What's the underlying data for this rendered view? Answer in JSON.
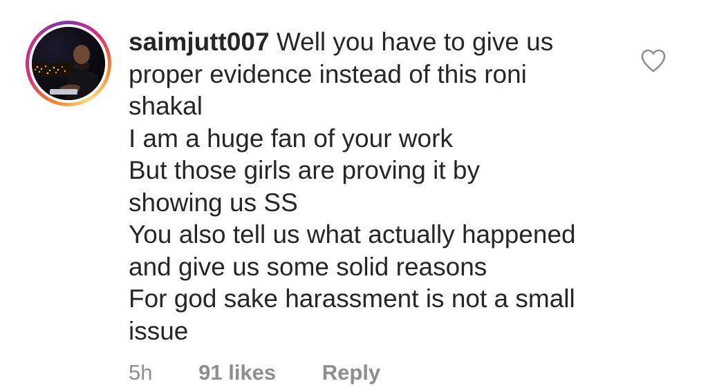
{
  "comment": {
    "username": "saimjutt007",
    "lines": [
      "Well you have to give us",
      "proper evidence instead of this roni",
      "shakal",
      "I am a huge fan of your work",
      "But those girls are proving it by",
      "showing us SS",
      "You also tell us what actually happened",
      "and give us some solid reasons",
      "For god sake harassment is not a small",
      "issue"
    ],
    "time": "5h",
    "likes": "91 likes",
    "reply_label": "Reply",
    "avatar_icon": "avatar-photo",
    "like_icon": "heart-outline-icon"
  },
  "colors": {
    "text": "#262626",
    "meta": "#8e8e8e",
    "ring_start": "#f58529",
    "ring_end": "#dd2a7b"
  }
}
